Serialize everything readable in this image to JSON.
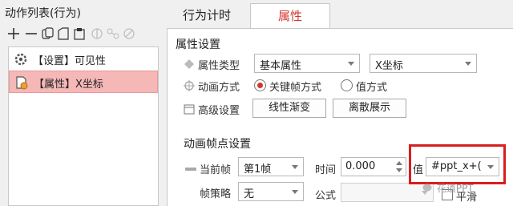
{
  "left_panel": {
    "title": "动作列表(行为)",
    "toolbar": [
      "add-icon",
      "remove-icon",
      "copy-icon",
      "paste-icon",
      "clipboard-icon",
      "compare-icon",
      "transfer-icon",
      "link-icon"
    ],
    "items": [
      {
        "label": "【设置】可见性",
        "icon": "gear-icon",
        "selected": false
      },
      {
        "label": "【属性】X坐标",
        "icon": "property-doc-icon",
        "selected": true
      }
    ]
  },
  "tabs": [
    {
      "label": "行为计时",
      "active": false
    },
    {
      "label": "属性",
      "active": true
    }
  ],
  "property_settings": {
    "section_title": "属性设置",
    "type_label": "属性类型",
    "type_value": "基本属性",
    "target_value": "X坐标",
    "animation_label": "动画方式",
    "radio_keyframe": "关键帧方式",
    "radio_value": "值方式",
    "advanced_label": "高级设置",
    "btn_linear": "线性渐变",
    "btn_discrete": "离散展示"
  },
  "keyframe_settings": {
    "section_title": "动画帧点设置",
    "current_label": "当前帧",
    "current_value": "第1帧",
    "time_label": "时间",
    "time_value": "0.000",
    "value_label": "值",
    "value_value": "#ppt_x+(",
    "strategy_label": "帧策略",
    "strategy_value": "无",
    "formula_label": "公式",
    "formula_value": "",
    "smooth_label": "平滑"
  },
  "watermark": "花道PPT",
  "colors": {
    "accent": "#d2372c",
    "highlight_border": "#d81e1e",
    "selected_row": "#f6b7b7"
  }
}
